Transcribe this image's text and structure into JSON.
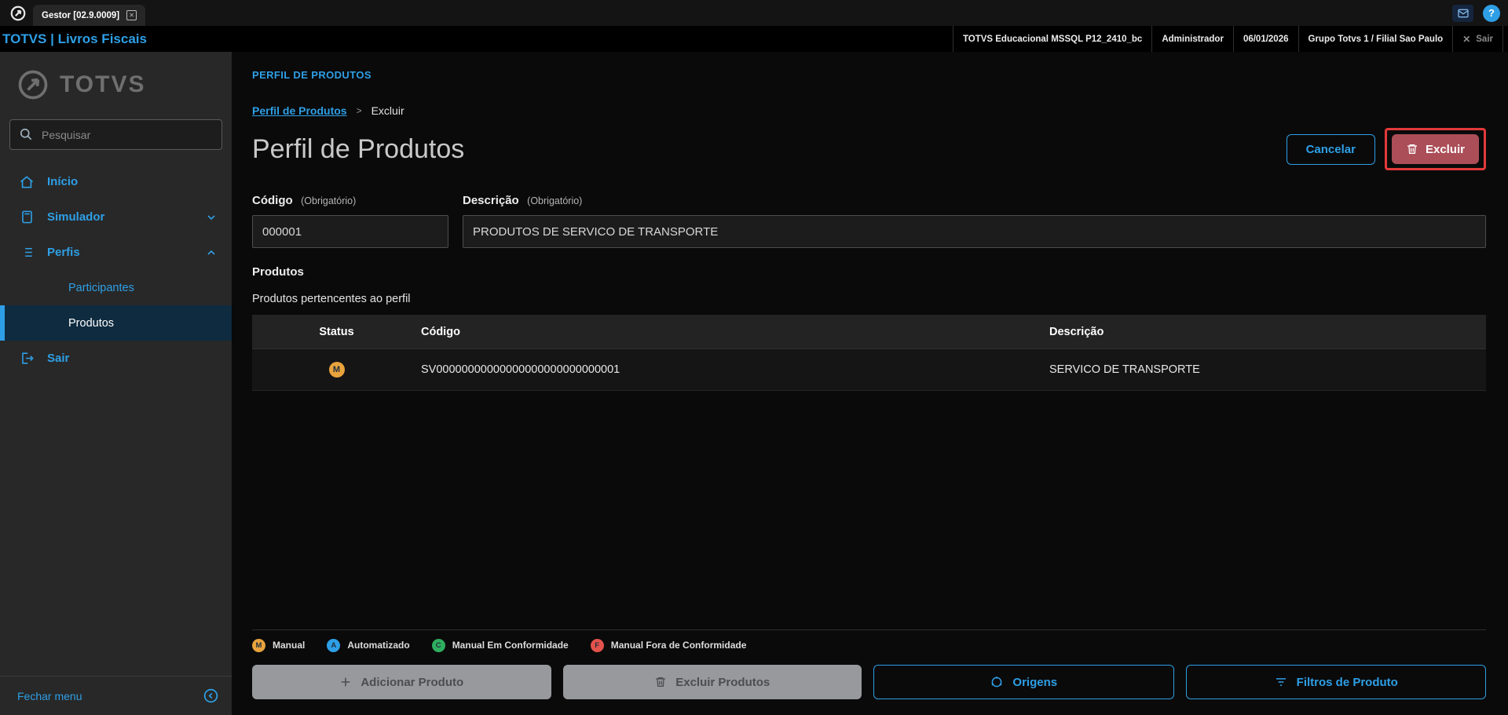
{
  "colors": {
    "accent": "#2e9fe6",
    "danger": "#ab4e58",
    "annotation": "#e23a3a"
  },
  "titlebar": {
    "tab": "Gestor [02.9.0009]"
  },
  "topbar": {
    "title": "TOTVS | Livros Fiscais",
    "cells": [
      "TOTVS Educacional MSSQL P12_2410_bc",
      "Administrador",
      "06/01/2026",
      "Grupo Totvs 1 / Filial Sao Paulo"
    ],
    "exit": "Sair"
  },
  "sidebar": {
    "logo": "TOTVS",
    "search_placeholder": "Pesquisar",
    "items": [
      {
        "label": "Início"
      },
      {
        "label": "Simulador"
      },
      {
        "label": "Perfis"
      },
      {
        "label": "Participantes"
      },
      {
        "label": "Produtos"
      },
      {
        "label": "Sair"
      }
    ],
    "footer": "Fechar menu"
  },
  "main": {
    "section_header": "PERFIL DE PRODUTOS",
    "breadcrumb": {
      "parent": "Perfil de Produtos",
      "separator": ">",
      "current": "Excluir"
    },
    "page_title": "Perfil de Produtos",
    "cancel_button": "Cancelar",
    "delete_button": "Excluir",
    "form": {
      "codigo": {
        "label": "Código",
        "required": "(Obrigatório)",
        "value": "000001"
      },
      "descricao": {
        "label": "Descrição",
        "required": "(Obrigatório)",
        "value": "PRODUTOS DE SERVICO DE TRANSPORTE"
      }
    },
    "products": {
      "label": "Produtos",
      "subtitle": "Produtos pertencentes ao perfil",
      "headers": {
        "status": "Status",
        "codigo": "Código",
        "descricao": "Descrição"
      },
      "rows": [
        {
          "status_letter": "M",
          "status_color": "#e8a33d",
          "codigo": "SV00000000000000000000000000001",
          "descricao": "SERVICO DE TRANSPORTE"
        }
      ]
    },
    "legend": [
      {
        "letter": "M",
        "label": "Manual",
        "color": "#e8a33d"
      },
      {
        "letter": "A",
        "label": "Automatizado",
        "color": "#2e9fe6"
      },
      {
        "letter": "C",
        "label": "Manual Em Conformidade",
        "color": "#2eae5e"
      },
      {
        "letter": "F",
        "label": "Manual Fora de Conformidade",
        "color": "#e4524c"
      }
    ],
    "footer_buttons": {
      "add": "Adicionar Produto",
      "delete": "Excluir Produtos",
      "origins": "Origens",
      "filters": "Filtros de Produto"
    }
  }
}
